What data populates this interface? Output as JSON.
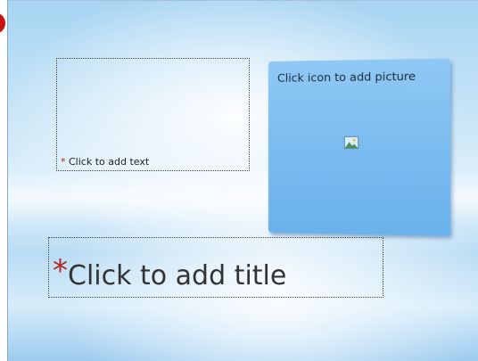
{
  "slide": {
    "text_placeholder": {
      "marker": "*",
      "label": "Click to add text"
    },
    "picture_placeholder": {
      "label": "Click icon to add picture",
      "icon": "insert-picture-icon"
    },
    "title_placeholder": {
      "marker": "*",
      "label": "Click to add title"
    }
  },
  "colors": {
    "marker_red": "#b3261e",
    "picture_card_blue": "#7bbcf0",
    "background_blue": "#a6d4f2"
  }
}
